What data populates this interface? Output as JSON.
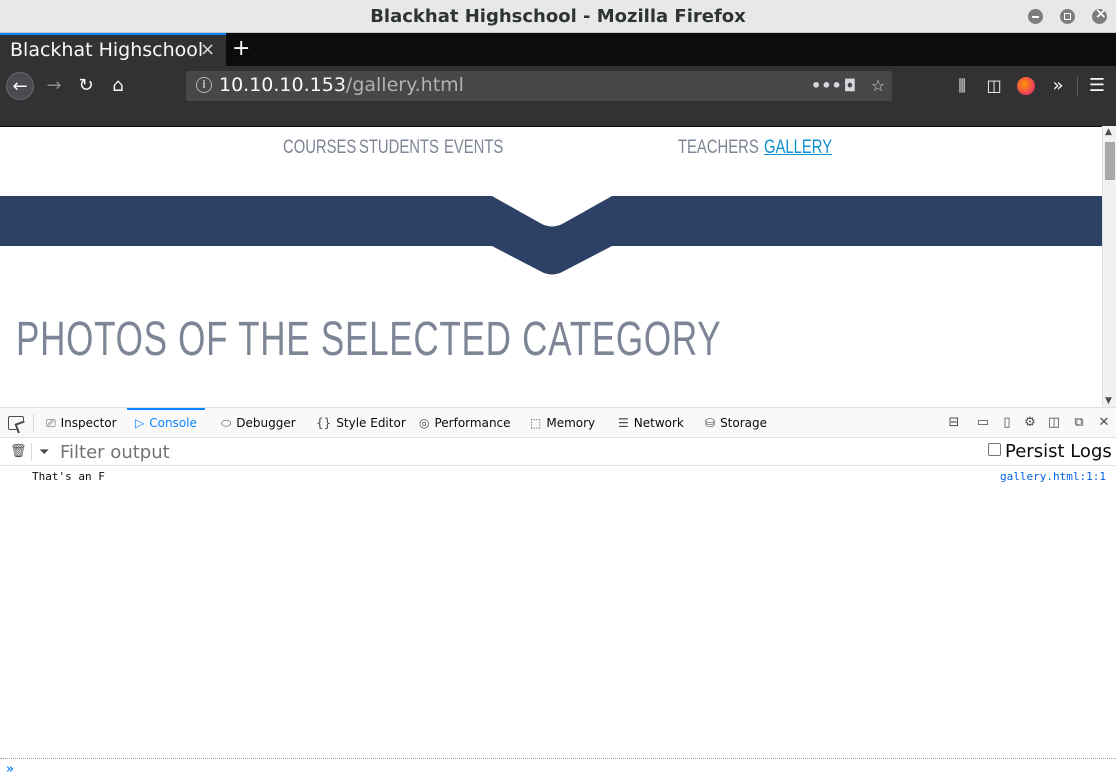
{
  "window": {
    "title": "Blackhat Highschool - Mozilla Firefox"
  },
  "tabs": [
    {
      "title": "Blackhat Highschool",
      "active": true
    }
  ],
  "urlbar": {
    "host": "10.10.10.153",
    "path": "/gallery.html"
  },
  "icons": {
    "back": "←",
    "forward": "→",
    "reload": "↻",
    "home": "⌂",
    "info": "i",
    "more": "•••",
    "pocket": "◘",
    "star": "☆",
    "library": "⫼",
    "sidebar": "◫",
    "overflow": "»",
    "menu": "☰",
    "close": "×",
    "new_tab": "+"
  },
  "site": {
    "nav": [
      {
        "label": "COURSES",
        "active": false
      },
      {
        "label": "STUDENTS",
        "active": false
      },
      {
        "label": "EVENTS",
        "active": false
      },
      {
        "label": "TEACHERS",
        "active": false
      },
      {
        "label": "GALLERY",
        "active": true
      }
    ],
    "heading": "PHOTOS OF THE SELECTED CATEGORY",
    "colors": {
      "banner": "#2d4066",
      "nav_text": "#7d8596",
      "nav_active": "#0f8fcf"
    }
  },
  "devtools": {
    "tabs": [
      {
        "label": "Inspector",
        "icon": "⎚"
      },
      {
        "label": "Console",
        "icon": "▷",
        "selected": true
      },
      {
        "label": "Debugger",
        "icon": "⬭"
      },
      {
        "label": "Style Editor",
        "icon": "{}"
      },
      {
        "label": "Performance",
        "icon": "◎"
      },
      {
        "label": "Memory",
        "icon": "⬚"
      },
      {
        "label": "Network",
        "icon": "☰"
      },
      {
        "label": "Storage",
        "icon": "⛁"
      }
    ],
    "filter_placeholder": "Filter output",
    "persist_logs_label": "Persist Logs",
    "persist_logs_checked": false,
    "messages": [
      {
        "text": "That's an F",
        "location": "gallery.html:1:1"
      }
    ],
    "prompt": "»"
  }
}
